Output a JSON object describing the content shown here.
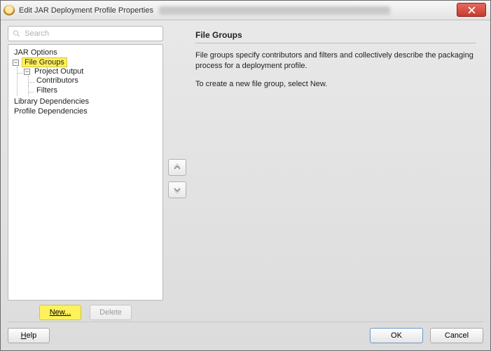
{
  "titlebar": {
    "title": "Edit JAR Deployment Profile Properties"
  },
  "search": {
    "placeholder": "Search"
  },
  "tree": {
    "jar_options": "JAR Options",
    "file_groups": "File Groups",
    "project_output": "Project Output",
    "contributors": "Contributors",
    "filters": "Filters",
    "library_dependencies": "Library Dependencies",
    "profile_dependencies": "Profile Dependencies"
  },
  "left_buttons": {
    "new": "New...",
    "delete": "Delete"
  },
  "content": {
    "heading": "File Groups",
    "p1": "File groups specify contributors and filters and collectively describe the packaging process for a deployment profile.",
    "p2": "To create a new file group, select New."
  },
  "footer": {
    "help": "Help",
    "ok": "OK",
    "cancel": "Cancel"
  }
}
